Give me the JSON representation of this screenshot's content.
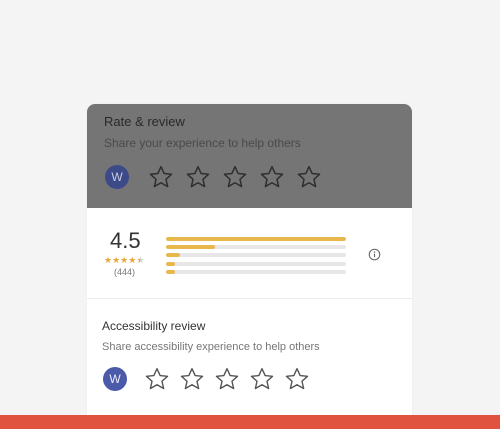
{
  "rate_review": {
    "title": "Rate & review",
    "subtitle": "Share your experience to help others",
    "avatar_letter": "W",
    "stars": [
      "star-1",
      "star-2",
      "star-3",
      "star-4",
      "star-5"
    ]
  },
  "summary": {
    "score": "4.5",
    "rating_stars": 4.5,
    "count": "(444)",
    "distribution": [
      {
        "stars": 5,
        "fraction": 1.0
      },
      {
        "stars": 4,
        "fraction": 0.27
      },
      {
        "stars": 3,
        "fraction": 0.08
      },
      {
        "stars": 2,
        "fraction": 0.05
      },
      {
        "stars": 1,
        "fraction": 0.05
      }
    ],
    "info_icon": "info-icon"
  },
  "accessibility": {
    "title": "Accessibility review",
    "subtitle": "Share accessibility experience to help others",
    "avatar_letter": "W"
  },
  "colors": {
    "overlay": "#757575",
    "star_fill": "#e8b84d",
    "avatar": "#3f51a3",
    "bottom_strip": "#e0533f"
  }
}
